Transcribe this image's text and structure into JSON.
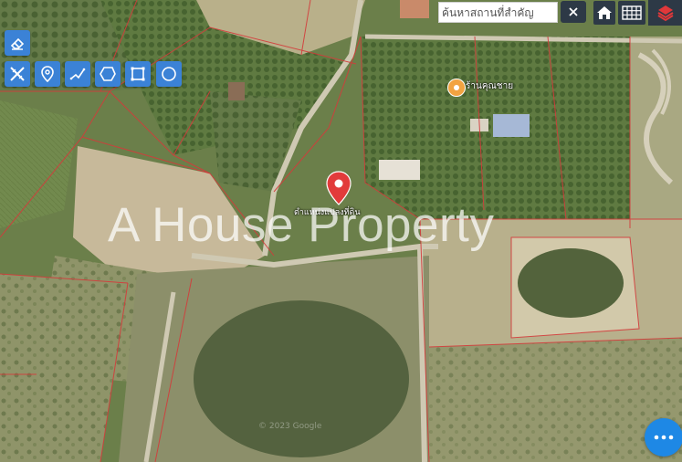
{
  "search": {
    "placeholder": "ค้นหาสถานที่สำคัญ",
    "clear_icon": "close-icon"
  },
  "toolbar": {
    "eraser_icon": "eraser-icon",
    "tools": [
      "measure-icon",
      "location-pin-icon",
      "line-draw-icon",
      "polygon-icon",
      "rectangle-icon",
      "circle-icon"
    ]
  },
  "top_right": {
    "home_icon": "home-icon",
    "grid_icon": "grid-icon",
    "layers_icon": "layers-icon"
  },
  "map": {
    "poi_label": "ร้านคุณชาย",
    "pin_label": "ตำแหน่งแปลงที่ดิน",
    "watermark": "A House Property",
    "copyright": "© 2023 Google",
    "pin_color": "#e23b3b",
    "accent": "#3b82d6"
  },
  "fab": {
    "icon": "more-dots-icon"
  }
}
